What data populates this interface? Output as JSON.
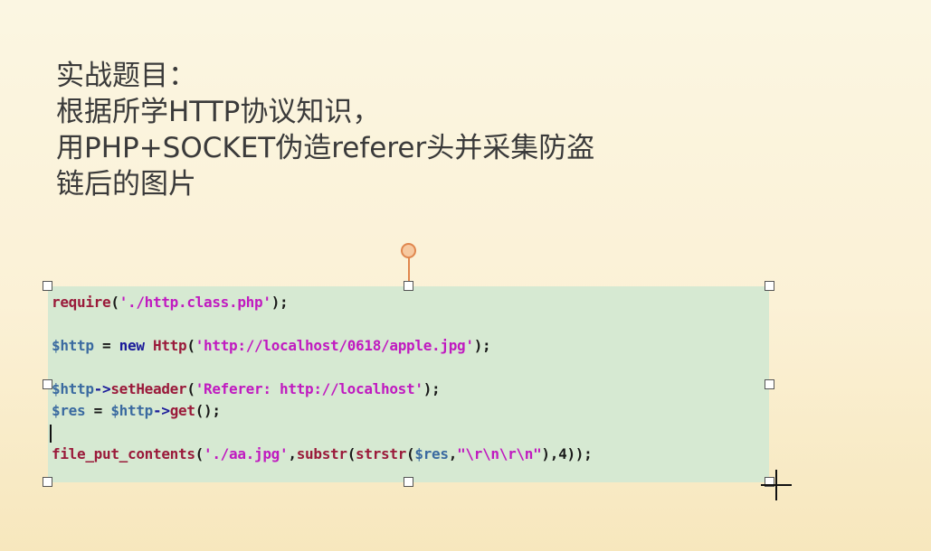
{
  "slide": {
    "title_lines": [
      "实战题目：",
      "根据所学HTTP协议知识，",
      "用PHP+SOCKET伪造referer头并采集防盗",
      "链后的图片"
    ]
  },
  "code": {
    "line1": {
      "fn": "require",
      "p1": "(",
      "str": "'./http.class.php'",
      "p2": ");"
    },
    "line2": {
      "var": "$http",
      "eq": " = ",
      "kw": "new",
      "sp": " ",
      "cls": "Http",
      "p1": "(",
      "str": "'http://localhost/0618/apple.jpg'",
      "p2": ");"
    },
    "line3": {
      "var": "$http",
      "arrow": "->",
      "fn": "setHeader",
      "p1": "(",
      "str": "'Referer: http://localhost'",
      "p2": ");"
    },
    "line4": {
      "var": "$res",
      "eq": " = ",
      "var2": "$http",
      "arrow": "->",
      "fn": "get",
      "p": "();"
    },
    "line5": {
      "fn": "file_put_contents",
      "p1": "(",
      "str1": "'./aa.jpg'",
      "comma1": ",",
      "fn2": "substr",
      "p2": "(",
      "fn3": "strstr",
      "p3": "(",
      "var": "$res",
      "comma2": ",",
      "str2": "\"\\r\\n\\r\\n\"",
      "p4": "),",
      "num": "4",
      "p5": "));"
    }
  },
  "colors": {
    "code_background": "#d6e9d2",
    "keyword": "#1a1a9a",
    "function": "#9a1a3a",
    "string": "#c01ac0",
    "variable": "#3a6aa0",
    "rotation_handle": "#e0874e"
  }
}
